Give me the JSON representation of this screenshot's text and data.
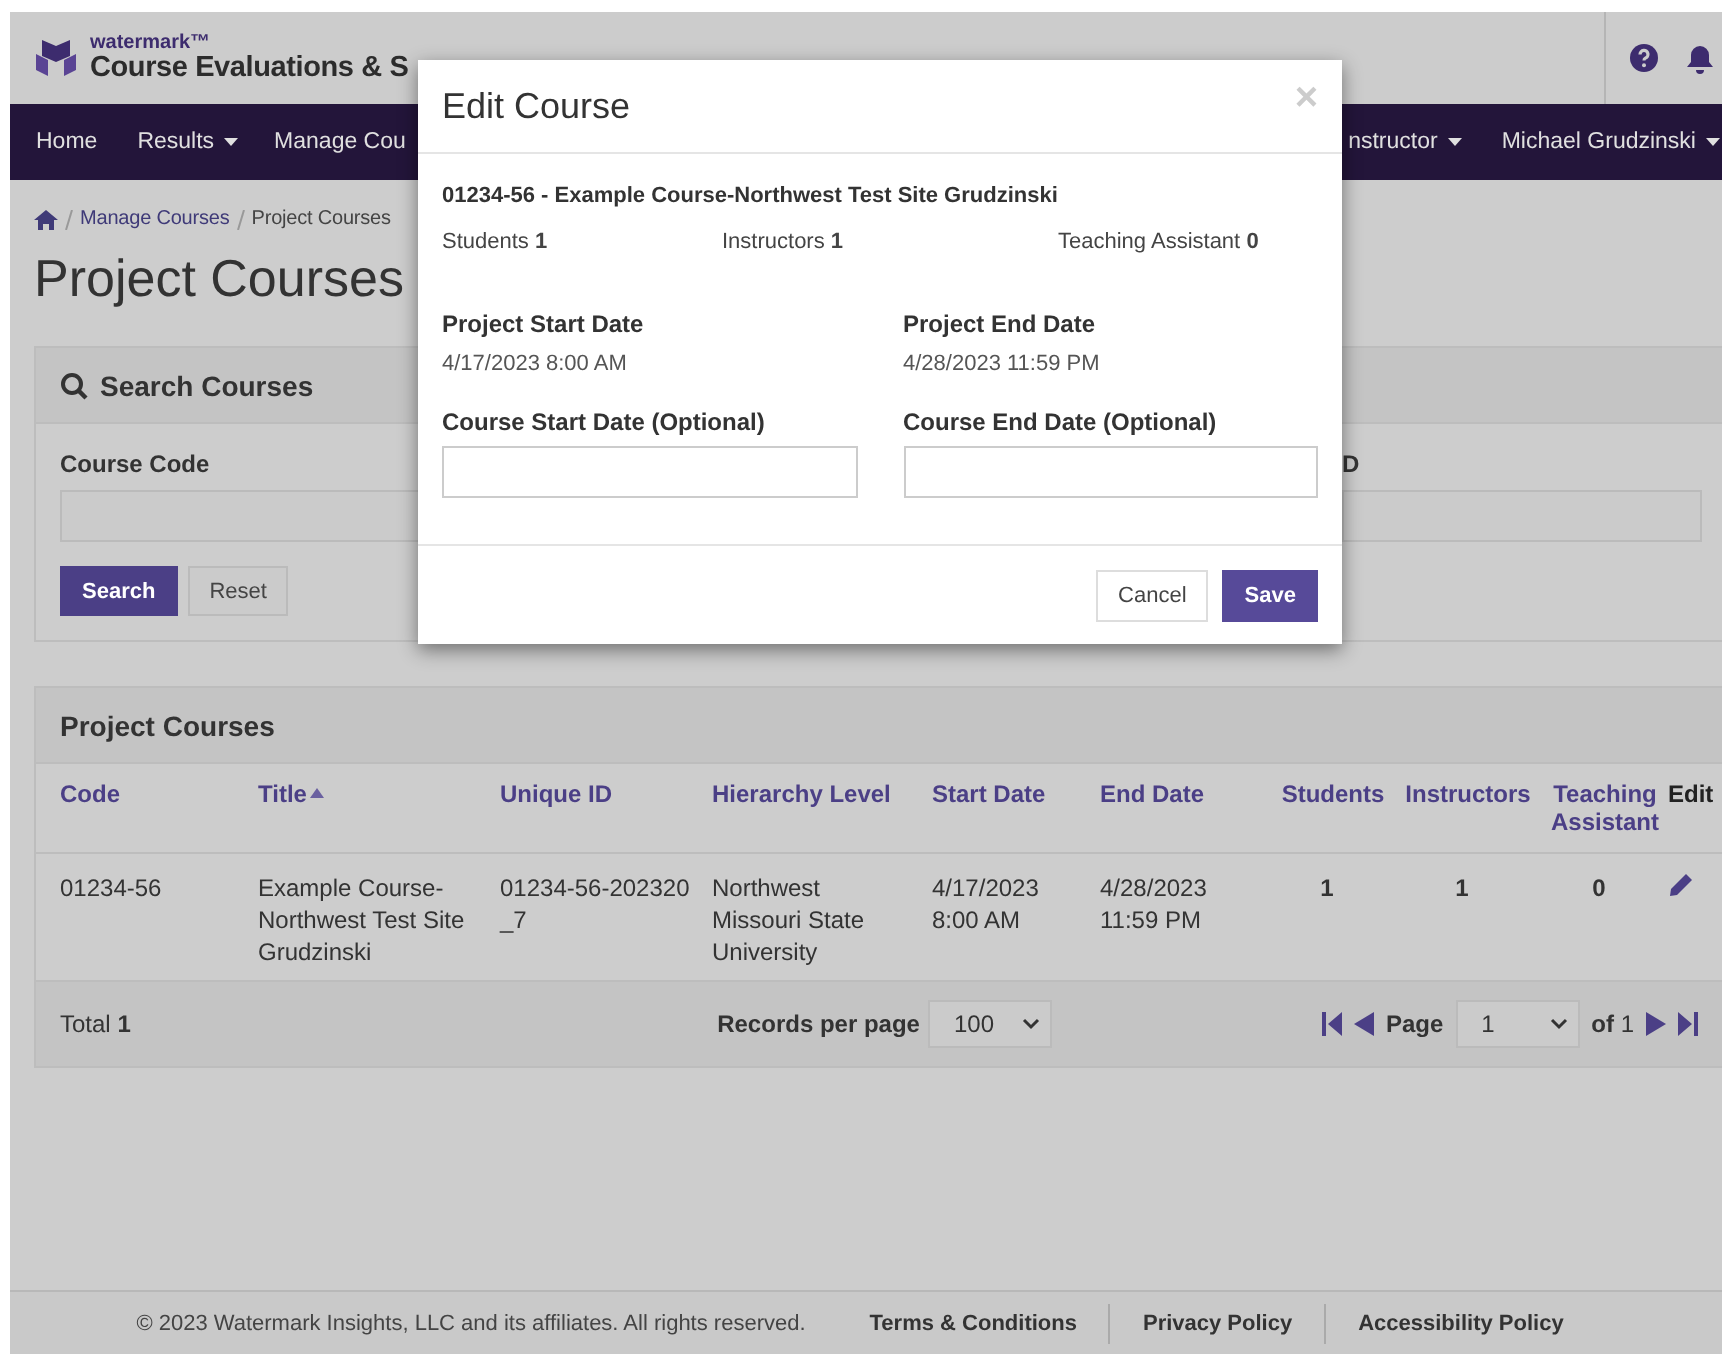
{
  "header": {
    "brand": "watermark™",
    "app_title": "Course Evaluations & S"
  },
  "nav": {
    "left": [
      {
        "label": "Home",
        "caret": false
      },
      {
        "label": "Results",
        "caret": true
      },
      {
        "label": "Manage Cou",
        "caret": false
      }
    ],
    "right": [
      {
        "label": "nstructor",
        "caret": true
      },
      {
        "label": "Michael Grudzinski",
        "caret": true
      }
    ]
  },
  "breadcrumb": [
    "Manage Courses",
    "Project Courses"
  ],
  "page_title": "Project Courses",
  "search_panel": {
    "title": "Search Courses",
    "fields": [
      {
        "label": "Course Code"
      },
      {
        "label": "D"
      }
    ],
    "buttons": [
      {
        "label": "Search",
        "primary": true
      },
      {
        "label": "Reset",
        "primary": false
      }
    ]
  },
  "courses_panel": {
    "title": "Project Courses",
    "columns": [
      {
        "label": "Code",
        "link": true,
        "sorted": false
      },
      {
        "label": "Title",
        "link": true,
        "sorted": true
      },
      {
        "label": "Unique ID",
        "link": true,
        "sorted": false
      },
      {
        "label": "Hierarchy Level",
        "link": true,
        "sorted": false
      },
      {
        "label": "Start Date",
        "link": true,
        "sorted": false
      },
      {
        "label": "End Date",
        "link": true,
        "sorted": false
      },
      {
        "label": "Students",
        "link": true,
        "sorted": false
      },
      {
        "label": "Instructors",
        "link": true,
        "sorted": false
      },
      {
        "label": "Teaching Assistant",
        "link": true,
        "sorted": false
      },
      {
        "label": "Edit",
        "link": false,
        "sorted": false
      }
    ],
    "rows": [
      {
        "cells": [
          "01234-56",
          "Example Course-Northwest Test Site Grudzinski",
          "01234-56-202320 _7",
          "Northwest Missouri State University",
          "4/17/2023 8:00 AM",
          "4/28/2023 11:59 PM",
          "1",
          "1",
          "0"
        ]
      }
    ],
    "total": "Total **1**",
    "records_label": "Records per page",
    "records_value": "100",
    "page_label": "Page",
    "page_value": "1",
    "page_of": "**of** 1"
  },
  "modal": {
    "title": "Edit Course",
    "close": "×",
    "course": "01234-56 - Example Course-Northwest Test Site Grudzinski",
    "counts": [
      {
        "label": "Students",
        "value": "1"
      },
      {
        "label": "Instructors",
        "value": "1"
      },
      {
        "label": "Teaching Assistant",
        "value": "0"
      }
    ],
    "dates": [
      {
        "label": "Project Start Date",
        "value": "4/17/2023 8:00 AM"
      },
      {
        "label": "Project End Date",
        "value": "4/28/2023 11:59 PM"
      }
    ],
    "fields": [
      {
        "label": "Course Start Date (Optional)"
      },
      {
        "label": "Course End Date (Optional)"
      }
    ],
    "buttons": [
      {
        "label": "Cancel",
        "primary": false
      },
      {
        "label": "Save",
        "primary": true
      }
    ]
  },
  "footer": {
    "copyright": "© 2023 Watermark Insights, LLC and its affiliates. All rights reserved.",
    "links": [
      "Terms & Conditions",
      "Privacy Policy",
      "Accessibility Policy"
    ]
  }
}
